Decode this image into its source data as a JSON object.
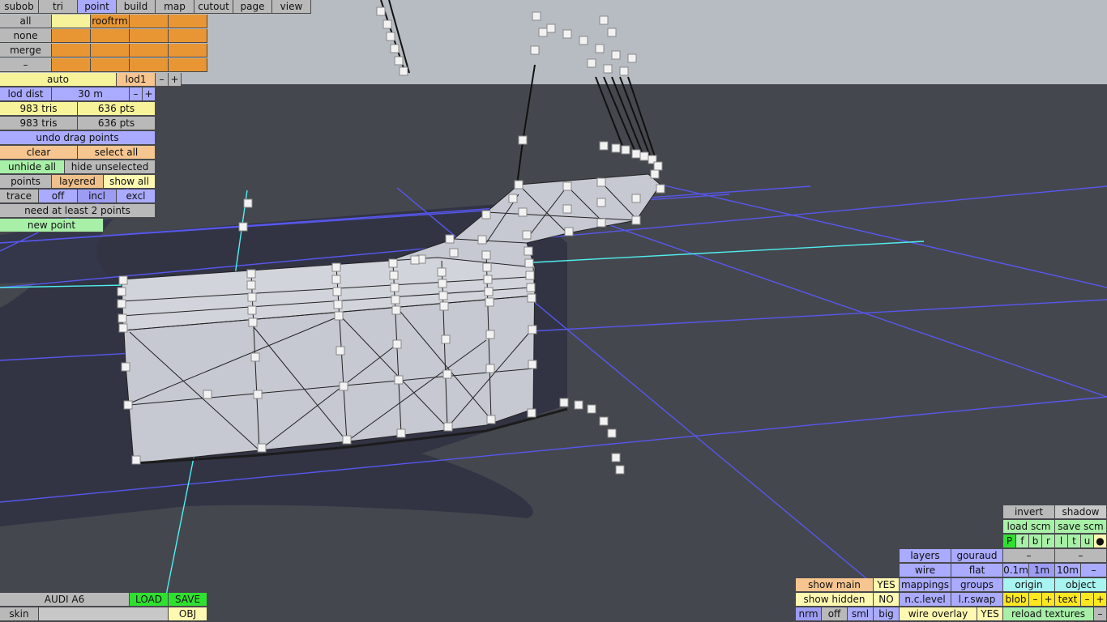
{
  "colors": {
    "sky": "#b7bcc2",
    "ground": "#45474e",
    "shadow": "#2f3140",
    "grid": "#5a5aff",
    "guide": "#4ff0f0",
    "mesh": "#c9cbd4"
  },
  "topbar": {
    "tabs": [
      "subob",
      "tri",
      "point",
      "build",
      "map",
      "cutout",
      "page",
      "view"
    ],
    "active": "point"
  },
  "layerpanel": {
    "all": "all",
    "none": "none",
    "merge": "merge",
    "minus": "–",
    "layer_name": "rooftrm"
  },
  "lod": {
    "auto": "auto",
    "lod": "lod1",
    "minus": "–",
    "plus": "+",
    "dist_label": "lod dist",
    "dist_value": "30 m"
  },
  "stats": {
    "tris1": "983 tris",
    "pts1": "636 pts",
    "tris2": "983 tris",
    "pts2": "636 pts"
  },
  "pointtools": {
    "undo": "undo drag points",
    "clear": "clear",
    "select_all": "select all",
    "unhide_all": "unhide all",
    "hide_unselected": "hide unselected",
    "points": "points",
    "layered": "layered",
    "show_all": "show all",
    "trace": "trace",
    "off": "off",
    "incl": "incl",
    "excl": "excl",
    "status": "need at least 2 points",
    "new_point": "new point"
  },
  "model": {
    "name": "AUDI A6",
    "load": "LOAD",
    "save": "SAVE",
    "skin": "skin",
    "skin_value": "",
    "obj": "OBJ"
  },
  "render": {
    "invert": "invert",
    "shadow": "shadow",
    "load_scm": "load scm",
    "save_scm": "save scm",
    "flags": [
      "P",
      "f",
      "b",
      "r",
      "l",
      "t",
      "u",
      "●"
    ],
    "layers": "layers",
    "gouraud": "gouraud",
    "dash1": "–",
    "dash2": "–",
    "wire": "wire",
    "flat": "flat",
    "m01": "0.1m",
    "m1": "1m",
    "m10": "10m",
    "mminus": "–",
    "show_main": "show main",
    "show_main_val": "YES",
    "mappings": "mappings",
    "groups": "groups",
    "origin": "origin",
    "object": "object",
    "show_hidden": "show hidden",
    "show_hidden_val": "NO",
    "nc_level": "n.c.level",
    "lr_swap": "l.r.swap",
    "blob": "blob",
    "blob_minus": "–",
    "blob_plus": "+",
    "text": "text",
    "text_minus": "–",
    "text_plus": "+",
    "nrm": "nrm",
    "off": "off",
    "sml": "sml",
    "big": "big",
    "wire_overlay": "wire overlay",
    "wire_overlay_val": "YES",
    "reload": "reload textures",
    "reload_minus": "–"
  }
}
